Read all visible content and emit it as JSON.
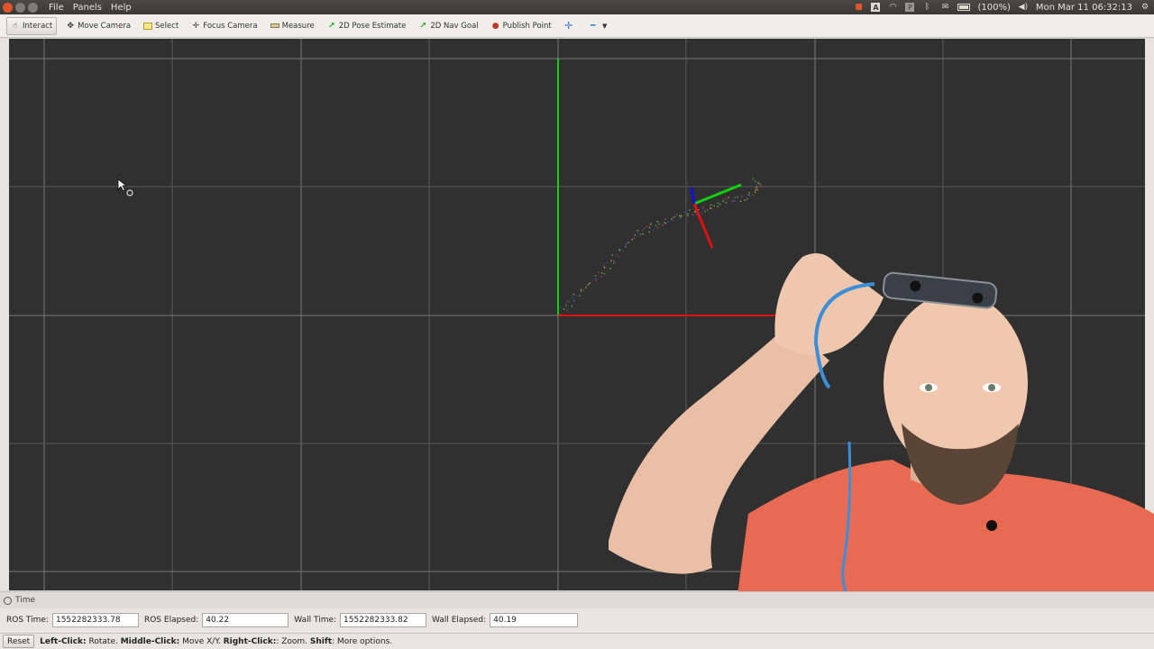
{
  "menubar": {
    "items": [
      "File",
      "Panels",
      "Help"
    ],
    "tray": {
      "battery_text": "(100%)",
      "clock": "Mon Mar 11 06:32:13",
      "battery_level": 1.0
    }
  },
  "toolbar": {
    "tools": [
      {
        "label": "Interact",
        "icon": "hand-icon"
      },
      {
        "label": "Move Camera",
        "icon": "move-camera-icon"
      },
      {
        "label": "Select",
        "icon": "select-icon"
      },
      {
        "label": "Focus Camera",
        "icon": "focus-camera-icon"
      },
      {
        "label": "Measure",
        "icon": "ruler-icon"
      },
      {
        "label": "2D Pose Estimate",
        "icon": "pose-arrow-icon"
      },
      {
        "label": "2D Nav Goal",
        "icon": "nav-arrow-icon"
      },
      {
        "label": "Publish Point",
        "icon": "map-pin-icon"
      }
    ]
  },
  "time_panel": {
    "title": "Time",
    "ros_time_label": "ROS Time:",
    "ros_time": "1552282333.78",
    "ros_elapsed_label": "ROS Elapsed:",
    "ros_elapsed": "40.22",
    "wall_time_label": "Wall Time:",
    "wall_time": "1552282333.82",
    "wall_elapsed_label": "Wall Elapsed:",
    "wall_elapsed": "40.19"
  },
  "statusbar": {
    "reset_label": "Reset",
    "left_click": "Left-Click:",
    "left_click_action": " Rotate. ",
    "middle_click": "Middle-Click:",
    "middle_click_action": " Move X/Y. ",
    "right_click": "Right-Click:",
    "right_click_action": ": Zoom. ",
    "shift": "Shift",
    "shift_action": ": More options."
  },
  "colors": {
    "viewport_bg": "#303030",
    "axis_x": "#e01010",
    "axis_y": "#10d010",
    "axis_z": "#1010e0",
    "grid": "#5a5a5a"
  }
}
